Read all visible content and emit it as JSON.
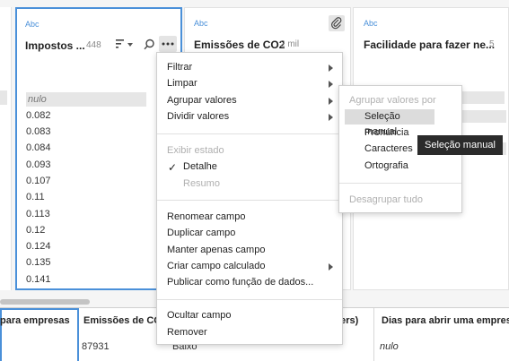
{
  "cards": [
    {
      "type": "Abc",
      "title": "Impostos ...",
      "count": "448",
      "values": [
        "nulo",
        "0.082",
        "0.083",
        "0.084",
        "0.093",
        "0.107",
        "0.11",
        "0.113",
        "0.12",
        "0.124",
        "0.135",
        "0.141"
      ]
    },
    {
      "type": "Abc",
      "title": "Emissões de CO2",
      "count": "2 mil"
    },
    {
      "type": "Abc",
      "title": "Facilidade para fazer ne...",
      "count": "5"
    }
  ],
  "context_menu": {
    "filter": "Filtrar",
    "clean": "Limpar",
    "group_values": "Agrupar valores",
    "split_values": "Dividir valores",
    "show_state": "Exibir estado",
    "detail": "Detalhe",
    "summary": "Resumo",
    "rename": "Renomear campo",
    "duplicate": "Duplicar campo",
    "keep_only": "Manter apenas campo",
    "create_calc": "Criar campo calculado",
    "publish_fn": "Publicar como função de dados...",
    "hide": "Ocultar campo",
    "remove": "Remover"
  },
  "submenu": {
    "header": "Agrupar valores por",
    "manual": "Seleção manual",
    "pronunciation": "Pronúncia",
    "characters": "Caracteres",
    "spelling": "Ortografia",
    "ungroup": "Desagrupar tudo"
  },
  "tooltip": "Seleção manual",
  "grid": {
    "headers": [
      "para empresas",
      "Emissões de CO",
      "cers)",
      "Dias para abrir uma empres"
    ],
    "row": [
      "",
      "87931",
      "Baixo",
      "",
      "nulo"
    ]
  },
  "icons": {
    "sort": "sort-icon",
    "search": "search-icon",
    "more": "more-icon",
    "attach": "paperclip-icon",
    "check": "checkmark-icon"
  },
  "colors": {
    "accent": "#4a90d9",
    "tooltip_bg": "#2b2b2b",
    "highlight": "#dcdcdc"
  }
}
